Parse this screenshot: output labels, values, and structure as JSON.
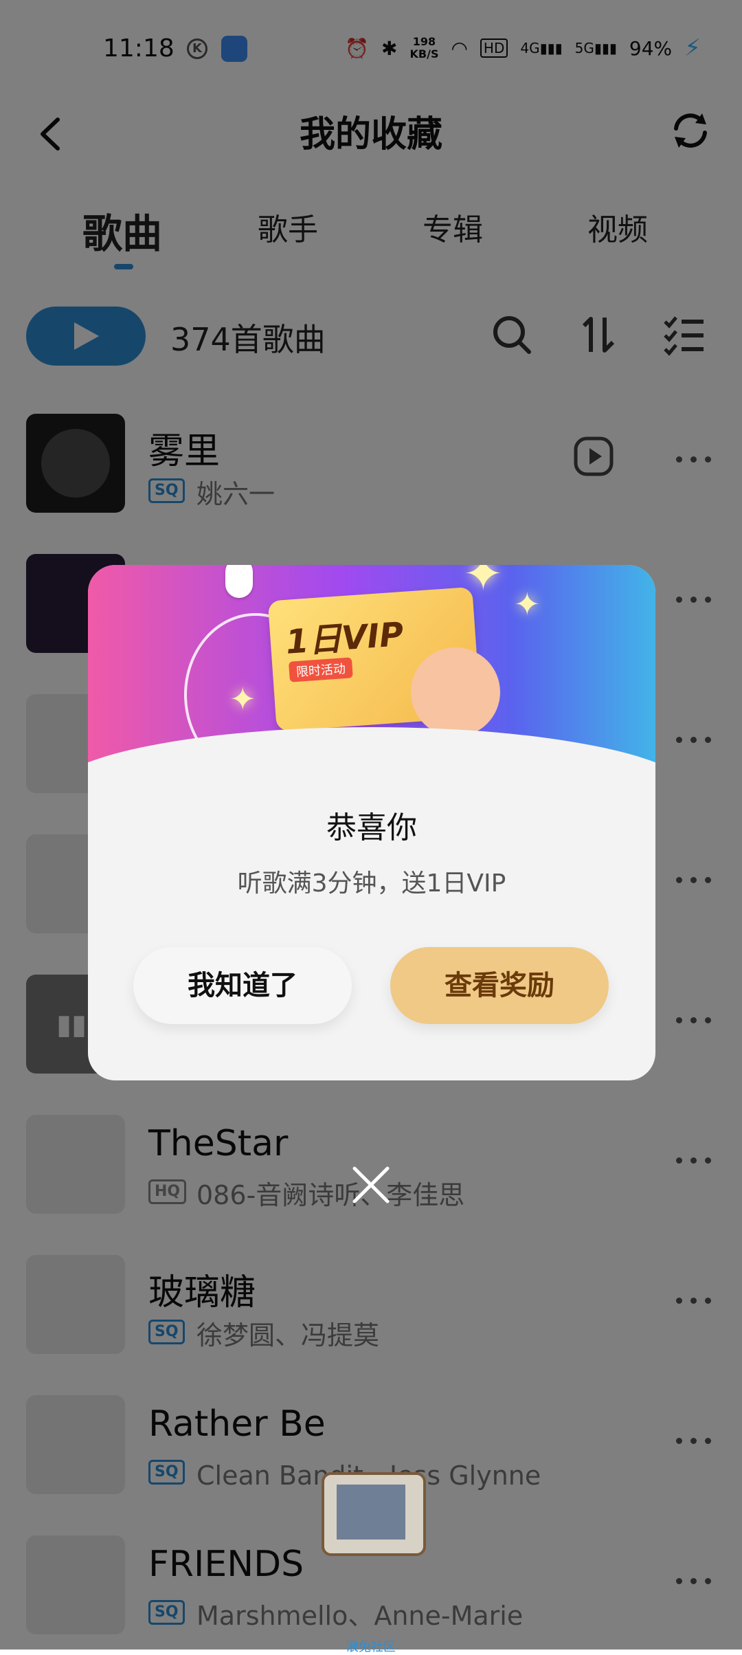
{
  "status_bar": {
    "time": "11:18",
    "k_icon": "K",
    "net_speed_value": "198",
    "net_speed_unit": "KB/S",
    "network_4g": "4G",
    "network_5g": "5G",
    "battery": "94%"
  },
  "header": {
    "title": "我的收藏"
  },
  "tabs": [
    {
      "label": "歌曲",
      "active": true
    },
    {
      "label": "歌手",
      "active": false
    },
    {
      "label": "专辑",
      "active": false
    },
    {
      "label": "视频",
      "active": false
    }
  ],
  "toolbar": {
    "count": "374首歌曲"
  },
  "songs": [
    {
      "title": "雾里",
      "quality": "SQ",
      "artist": "姚六一"
    },
    {
      "title": "TheStar",
      "quality": "HQ",
      "artist": "086-音阙诗听、李佳思"
    },
    {
      "title": "玻璃糖",
      "quality": "SQ",
      "artist": "徐梦圆、冯提莫"
    },
    {
      "title": "Rather Be",
      "quality": "SQ",
      "artist": "Clean Bandit、Jess Glynne"
    },
    {
      "title": "FRIENDS",
      "quality": "SQ",
      "artist": "Marshmello、Anne-Marie"
    }
  ],
  "modal": {
    "vip_card_title": "1日VIP",
    "vip_card_tag": "限时活动",
    "heading": "恭喜你",
    "subtitle": "听歌满3分钟，送1日VIP",
    "dismiss_label": "我知道了",
    "reward_label": "查看奖励"
  },
  "floating": {
    "community_label": "浪兔社区"
  },
  "colors": {
    "accent": "#2c8fd6",
    "reward_button": "#efc985"
  }
}
